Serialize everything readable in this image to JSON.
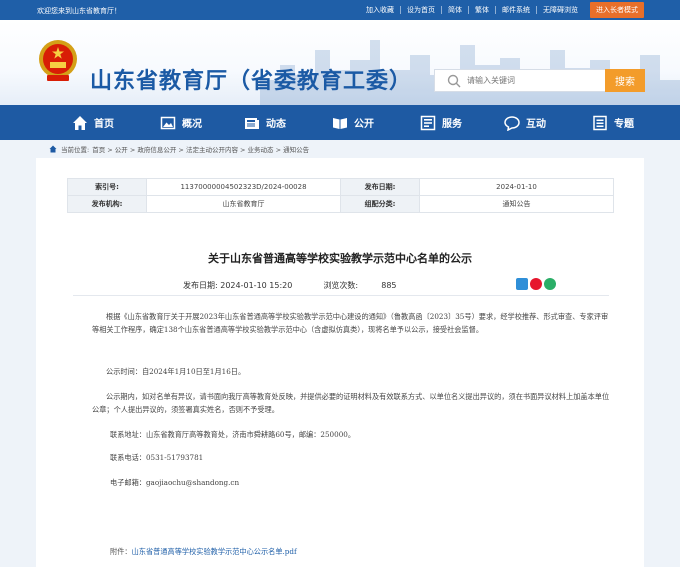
{
  "topbar": {
    "welcome": "欢迎您来到山东省教育厅！",
    "links": [
      "加入收藏",
      "设为首页",
      "简体",
      "繁体",
      "邮件系统",
      "无障碍浏览"
    ],
    "elder_mode": "进入长者模式"
  },
  "header": {
    "site_title": "山东省教育厅（省委教育工委）",
    "search_placeholder": "请输入关键词",
    "search_button": "搜索"
  },
  "nav": {
    "items": [
      {
        "label": "首页",
        "icon": "home-icon"
      },
      {
        "label": "概况",
        "icon": "image-icon"
      },
      {
        "label": "动态",
        "icon": "newspaper-icon"
      },
      {
        "label": "公开",
        "icon": "book-icon"
      },
      {
        "label": "服务",
        "icon": "service-icon"
      },
      {
        "label": "互动",
        "icon": "chat-icon"
      },
      {
        "label": "专题",
        "icon": "list-icon"
      }
    ]
  },
  "breadcrumb": {
    "prefix": "当前位置:",
    "path": "首页 > 公开 > 政府信息公开 > 法定主动公开内容 > 业务动态 > 通知公告"
  },
  "meta": {
    "index_label": "索引号:",
    "index_value": "11370000004502323D/2024-00028",
    "date_label": "发布日期:",
    "date_value": "2024-01-10",
    "org_label": "发布机构:",
    "org_value": "山东省教育厅",
    "category_label": "组配分类:",
    "category_value": "通知公告"
  },
  "article": {
    "title": "关于山东省普通高等学校实验教学示范中心名单的公示",
    "publish_label": "发布日期:",
    "publish_value": "2024-01-10 15:20",
    "views_label": "浏览次数:",
    "views_value": "885",
    "paragraphs": [
      "根据《山东省教育厅关于开展2023年山东省普通高等学校实验教学示范中心建设的通知》（鲁教高函〔2023〕35号）要求，经学校推荐、形式审查、专家评审等相关工作程序，确定138个山东省普通高等学校实验教学示范中心（含虚拟仿真类），现将名单予以公示，接受社会监督。",
      "公示时间：自2024年1月10日至1月16日。",
      "公示期内，如对名单有异议，请书面向我厅高等教育处反映，并提供必要的证明材料及有效联系方式、以单位名义提出异议的，须在书面异议材料上加盖本单位公章；个人提出异议的，须签署真实姓名，否则不予受理。",
      "联系地址：山东省教育厅高等教育处，济南市舜耕路60号，邮编：250000。",
      "联系电话：0531-51793781",
      "电子邮箱：gaojiaochu@shandong.cn"
    ],
    "attachment_label": "附件：",
    "attachment_name": "山东省普通高等学校实验教学示范中心公示名单.pdf"
  },
  "colors": {
    "brand_blue": "#1e5aa3",
    "accent_orange": "#f39c2b",
    "elder_orange": "#e86f2a"
  }
}
